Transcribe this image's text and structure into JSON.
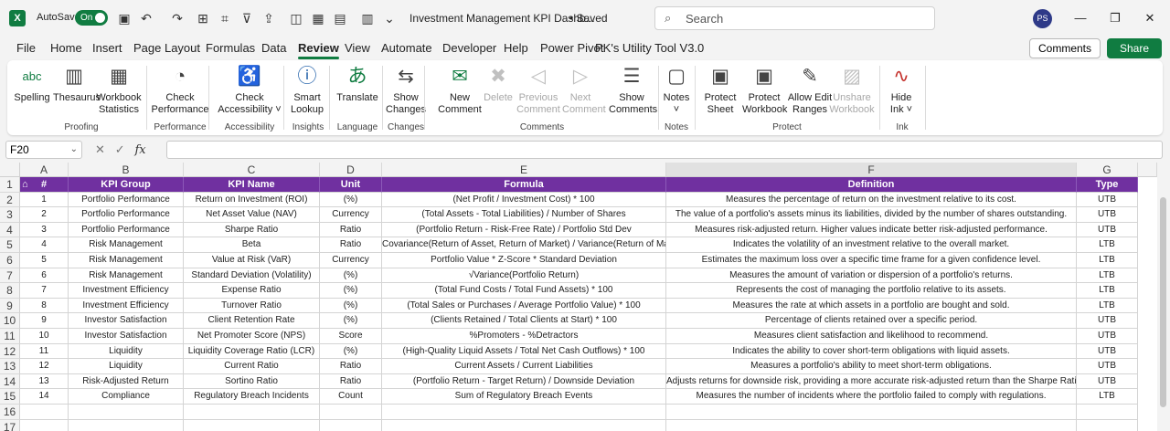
{
  "titlebar": {
    "autosave_label": "AutoSave",
    "autosave_state": "On",
    "doc_title": "Investment Management KPI Dashb...",
    "saved_label": "• Saved",
    "search_placeholder": "Search",
    "avatar_initials": "PS"
  },
  "menu": {
    "tabs": [
      "File",
      "Home",
      "Insert",
      "Page Layout",
      "Formulas",
      "Data",
      "Review",
      "View",
      "Automate",
      "Developer",
      "Help",
      "Power Pivot",
      "PK's Utility Tool V3.0"
    ],
    "active_tab": "Review",
    "comments_label": "Comments",
    "share_label": "Share"
  },
  "ribbon": {
    "buttons": [
      {
        "label": "Spelling",
        "icon": "spelling-icon",
        "enabled": true
      },
      {
        "label": "Thesaurus",
        "icon": "thesaurus-icon",
        "enabled": true
      },
      {
        "label": "Workbook\nStatistics",
        "icon": "workbook-statistics-icon",
        "enabled": true
      },
      {
        "label": "Check\nPerformance",
        "icon": "check-performance-icon",
        "enabled": true
      },
      {
        "label": "Check\nAccessibility ˅",
        "icon": "check-accessibility-icon",
        "enabled": true
      },
      {
        "label": "Smart\nLookup",
        "icon": "smart-lookup-icon",
        "enabled": true
      },
      {
        "label": "Translate",
        "icon": "translate-icon",
        "enabled": true
      },
      {
        "label": "Show\nChanges",
        "icon": "show-changes-icon",
        "enabled": true
      },
      {
        "label": "New\nComment",
        "icon": "new-comment-icon",
        "enabled": true
      },
      {
        "label": "Delete",
        "icon": "delete-comment-icon",
        "enabled": false
      },
      {
        "label": "Previous\nComment",
        "icon": "previous-comment-icon",
        "enabled": false
      },
      {
        "label": "Next\nComment",
        "icon": "next-comment-icon",
        "enabled": false
      },
      {
        "label": "Show\nComments",
        "icon": "show-comments-icon",
        "enabled": true
      },
      {
        "label": "Notes\n˅",
        "icon": "notes-icon",
        "enabled": true
      },
      {
        "label": "Protect\nSheet",
        "icon": "protect-sheet-icon",
        "enabled": true
      },
      {
        "label": "Protect\nWorkbook",
        "icon": "protect-workbook-icon",
        "enabled": true
      },
      {
        "label": "Allow Edit\nRanges",
        "icon": "allow-edit-ranges-icon",
        "enabled": true
      },
      {
        "label": "Unshare\nWorkbook",
        "icon": "unshare-workbook-icon",
        "enabled": false
      },
      {
        "label": "Hide\nInk ˅",
        "icon": "hide-ink-icon",
        "enabled": true
      }
    ],
    "groups": [
      "Proofing",
      "Performance",
      "Accessibility",
      "Insights",
      "Language",
      "Changes",
      "Comments",
      "Notes",
      "Protect",
      "Ink"
    ]
  },
  "formula_bar": {
    "name_box": "F20",
    "fx_label": "fx",
    "value": ""
  },
  "sheet": {
    "column_letters": [
      "A",
      "B",
      "C",
      "D",
      "E",
      "F",
      "G"
    ],
    "selected_column": "F",
    "row_numbers": [
      "1",
      "2",
      "3",
      "4",
      "5",
      "6",
      "7",
      "8",
      "9",
      "10",
      "11",
      "12",
      "13",
      "14",
      "15",
      "16",
      "17"
    ],
    "headers": [
      "#",
      "KPI Group",
      "KPI Name",
      "Unit",
      "Formula",
      "Definition",
      "Type"
    ],
    "rows": [
      [
        "1",
        "Portfolio Performance",
        "Return on Investment (ROI)",
        "(%)",
        "(Net Profit / Investment Cost) * 100",
        "Measures the percentage of return on the investment relative to its cost.",
        "UTB"
      ],
      [
        "2",
        "Portfolio Performance",
        "Net Asset Value (NAV)",
        "Currency",
        "(Total Assets - Total Liabilities) / Number of Shares",
        "The value of a portfolio's assets minus its liabilities, divided by the number of shares outstanding.",
        "UTB"
      ],
      [
        "3",
        "Portfolio Performance",
        "Sharpe Ratio",
        "Ratio",
        "(Portfolio Return - Risk-Free Rate) / Portfolio Std Dev",
        "Measures risk-adjusted return. Higher values indicate better risk-adjusted performance.",
        "UTB"
      ],
      [
        "4",
        "Risk Management",
        "Beta",
        "Ratio",
        "Covariance(Return of Asset, Return of Market) / Variance(Return of Market)",
        "Indicates the volatility of an investment relative to the overall market.",
        "LTB"
      ],
      [
        "5",
        "Risk Management",
        "Value at Risk (VaR)",
        "Currency",
        "Portfolio Value * Z-Score * Standard Deviation",
        "Estimates the maximum loss over a specific time frame for a given confidence level.",
        "LTB"
      ],
      [
        "6",
        "Risk Management",
        "Standard Deviation (Volatility)",
        "(%)",
        "√Variance(Portfolio Return)",
        "Measures the amount of variation or dispersion of a portfolio's returns.",
        "LTB"
      ],
      [
        "7",
        "Investment Efficiency",
        "Expense Ratio",
        "(%)",
        "(Total Fund Costs / Total Fund Assets) * 100",
        "Represents the cost of managing the portfolio relative to its assets.",
        "LTB"
      ],
      [
        "8",
        "Investment Efficiency",
        "Turnover Ratio",
        "(%)",
        "(Total Sales or Purchases / Average Portfolio Value) * 100",
        "Measures the rate at which assets in a portfolio are bought and sold.",
        "LTB"
      ],
      [
        "9",
        "Investor Satisfaction",
        "Client Retention Rate",
        "(%)",
        "(Clients Retained / Total Clients at Start) * 100",
        "Percentage of clients retained over a specific period.",
        "UTB"
      ],
      [
        "10",
        "Investor Satisfaction",
        "Net Promoter Score (NPS)",
        "Score",
        "%Promoters - %Detractors",
        "Measures client satisfaction and likelihood to recommend.",
        "UTB"
      ],
      [
        "11",
        "Liquidity",
        "Liquidity Coverage Ratio (LCR)",
        "(%)",
        "(High-Quality Liquid Assets / Total Net Cash Outflows) * 100",
        "Indicates the ability to cover short-term obligations with liquid assets.",
        "UTB"
      ],
      [
        "12",
        "Liquidity",
        "Current Ratio",
        "Ratio",
        "Current Assets / Current Liabilities",
        "Measures a portfolio's ability to meet short-term obligations.",
        "UTB"
      ],
      [
        "13",
        "Risk-Adjusted Return",
        "Sortino Ratio",
        "Ratio",
        "(Portfolio Return - Target Return) / Downside Deviation",
        "Adjusts returns for downside risk, providing a more accurate risk-adjusted return than the Sharpe Ratio.",
        "UTB"
      ],
      [
        "14",
        "Compliance",
        "Regulatory Breach Incidents",
        "Count",
        "Sum of Regulatory Breach Events",
        "Measures the number of incidents where the portfolio failed to comply with regulations.",
        "LTB"
      ]
    ],
    "colors": {
      "header_bg": "#7030a0",
      "accent": "#107c41"
    }
  }
}
